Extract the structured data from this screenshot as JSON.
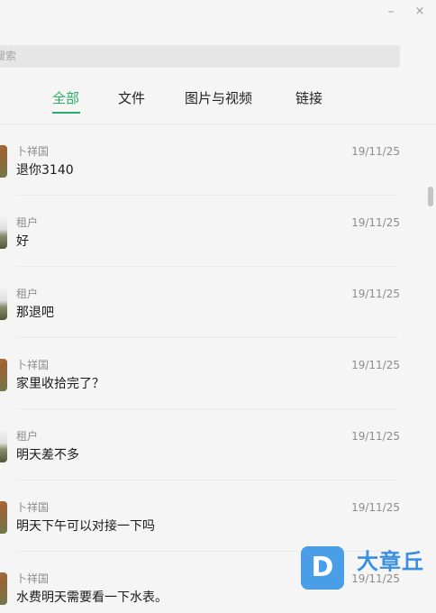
{
  "window_controls": {
    "minimize": "–",
    "close": "×"
  },
  "search": {
    "placeholder": "搜索"
  },
  "tabs": [
    {
      "label": "全部",
      "active": true
    },
    {
      "label": "文件",
      "active": false
    },
    {
      "label": "图片与视频",
      "active": false
    },
    {
      "label": "链接",
      "active": false
    }
  ],
  "messages": [
    {
      "sender": "卜祥国",
      "date": "19/11/25",
      "text": "退你3140",
      "avatar": "warm"
    },
    {
      "sender": "租户",
      "date": "19/11/25",
      "text": "好",
      "avatar": "cool"
    },
    {
      "sender": "租户",
      "date": "19/11/25",
      "text": "那退吧",
      "avatar": "cool"
    },
    {
      "sender": "卜祥国",
      "date": "19/11/25",
      "text": "家里收拾完了？",
      "avatar": "warm"
    },
    {
      "sender": "租户",
      "date": "19/11/25",
      "text": "明天差不多",
      "avatar": "cool"
    },
    {
      "sender": "卜祥国",
      "date": "19/11/25",
      "text": "明天下午可以对接一下吗",
      "avatar": "warm"
    },
    {
      "sender": "卜祥国",
      "date": "19/11/25",
      "text": "水费明天需要看一下水表。",
      "avatar": "warm"
    }
  ],
  "watermark": {
    "logo": "D",
    "text": "大章丘"
  },
  "colors": {
    "accent": "#2aae67",
    "background": "#f5f5f5",
    "watermark": "#3a8fe0"
  }
}
